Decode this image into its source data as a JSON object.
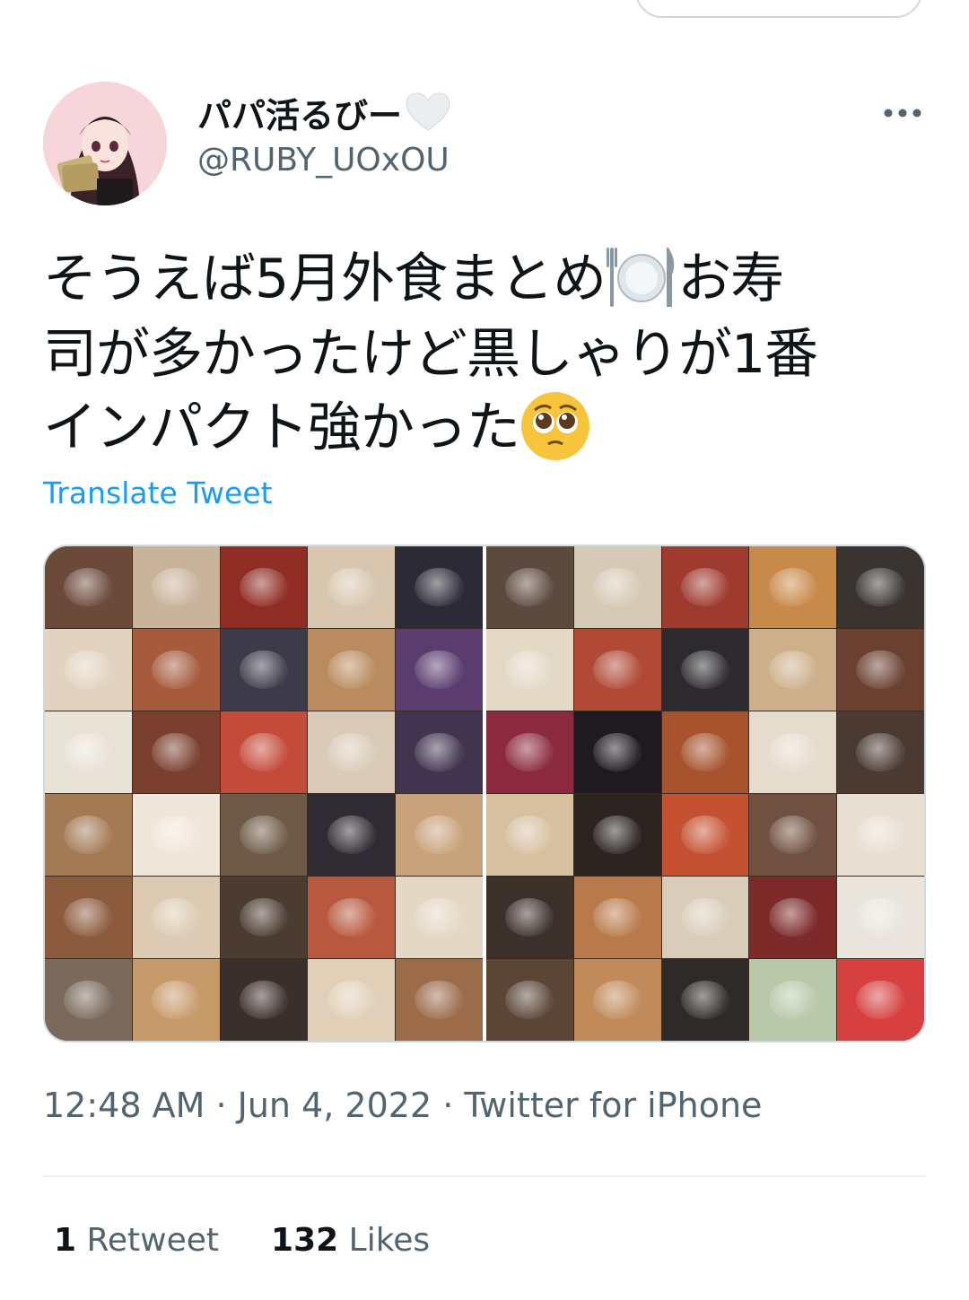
{
  "tweet": {
    "display_name": "パパ活るびー",
    "name_icon": "white-heart-icon",
    "handle": "@RUBY_UOxOU",
    "text_lines": [
      [
        "そうえば5月外食まとめ",
        "お寿"
      ],
      [
        "司が多かったけど黒しゃりが1番"
      ],
      [
        "インパクト強かった"
      ]
    ],
    "text_line1_a": "そうえば5月外食まとめ",
    "text_line1_b": "お寿",
    "text_line2": "司が多かったけど黒しゃりが1番",
    "text_line3": "インパクト強かった",
    "emoji_1": "fork-knife-plate-icon",
    "emoji_2": "pleading-face-icon",
    "translate_label": "Translate Tweet",
    "media": {
      "count": 2,
      "description_icons": [
        "food-collage-photo",
        "food-collage-photo"
      ]
    },
    "time": "12:48 AM",
    "date": "Jun 4, 2022",
    "source": "Twitter for iPhone",
    "separator": " · ",
    "retweets_count": "1",
    "retweets_label": "Retweet",
    "likes_count": "132",
    "likes_label": "Likes"
  },
  "colors": {
    "text": "#0f1419",
    "secondary": "#536471",
    "link": "#1d9bf0",
    "border": "#cfd9de"
  }
}
